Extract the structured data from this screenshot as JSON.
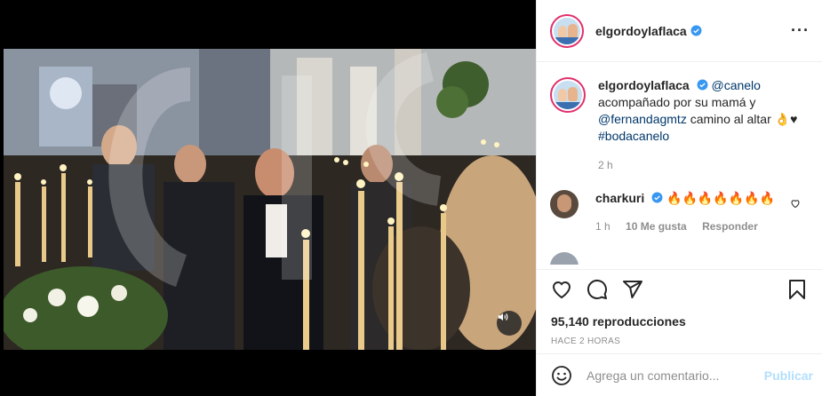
{
  "post": {
    "username": "elgordoylaflaca",
    "more_icon": "ellipsis-icon"
  },
  "caption": {
    "username": "elgordoylaflaca",
    "mention_1": "@canelo",
    "text_1": "acompañado por su mamá y",
    "mention_2": "@fernandagmtz",
    "text_2": "camino al altar 👌♥",
    "hashtag": "#bodacanelo",
    "time_ago": "2 h"
  },
  "comments": [
    {
      "username": "charkuri",
      "text": "🔥🔥🔥🔥🔥🔥🔥",
      "time": "1 h",
      "likes": "10 Me gusta",
      "reply": "Responder"
    }
  ],
  "stats": {
    "views": "95,140 reproducciones",
    "posted": "HACE 2 HORAS"
  },
  "composer": {
    "placeholder": "Agrega un comentario...",
    "publish_label": "Publicar"
  },
  "colors": {
    "link": "#00376b",
    "verified": "#3897f0",
    "publish_disabled": "#b2dffc",
    "secondary_text": "#8e8e8e"
  }
}
